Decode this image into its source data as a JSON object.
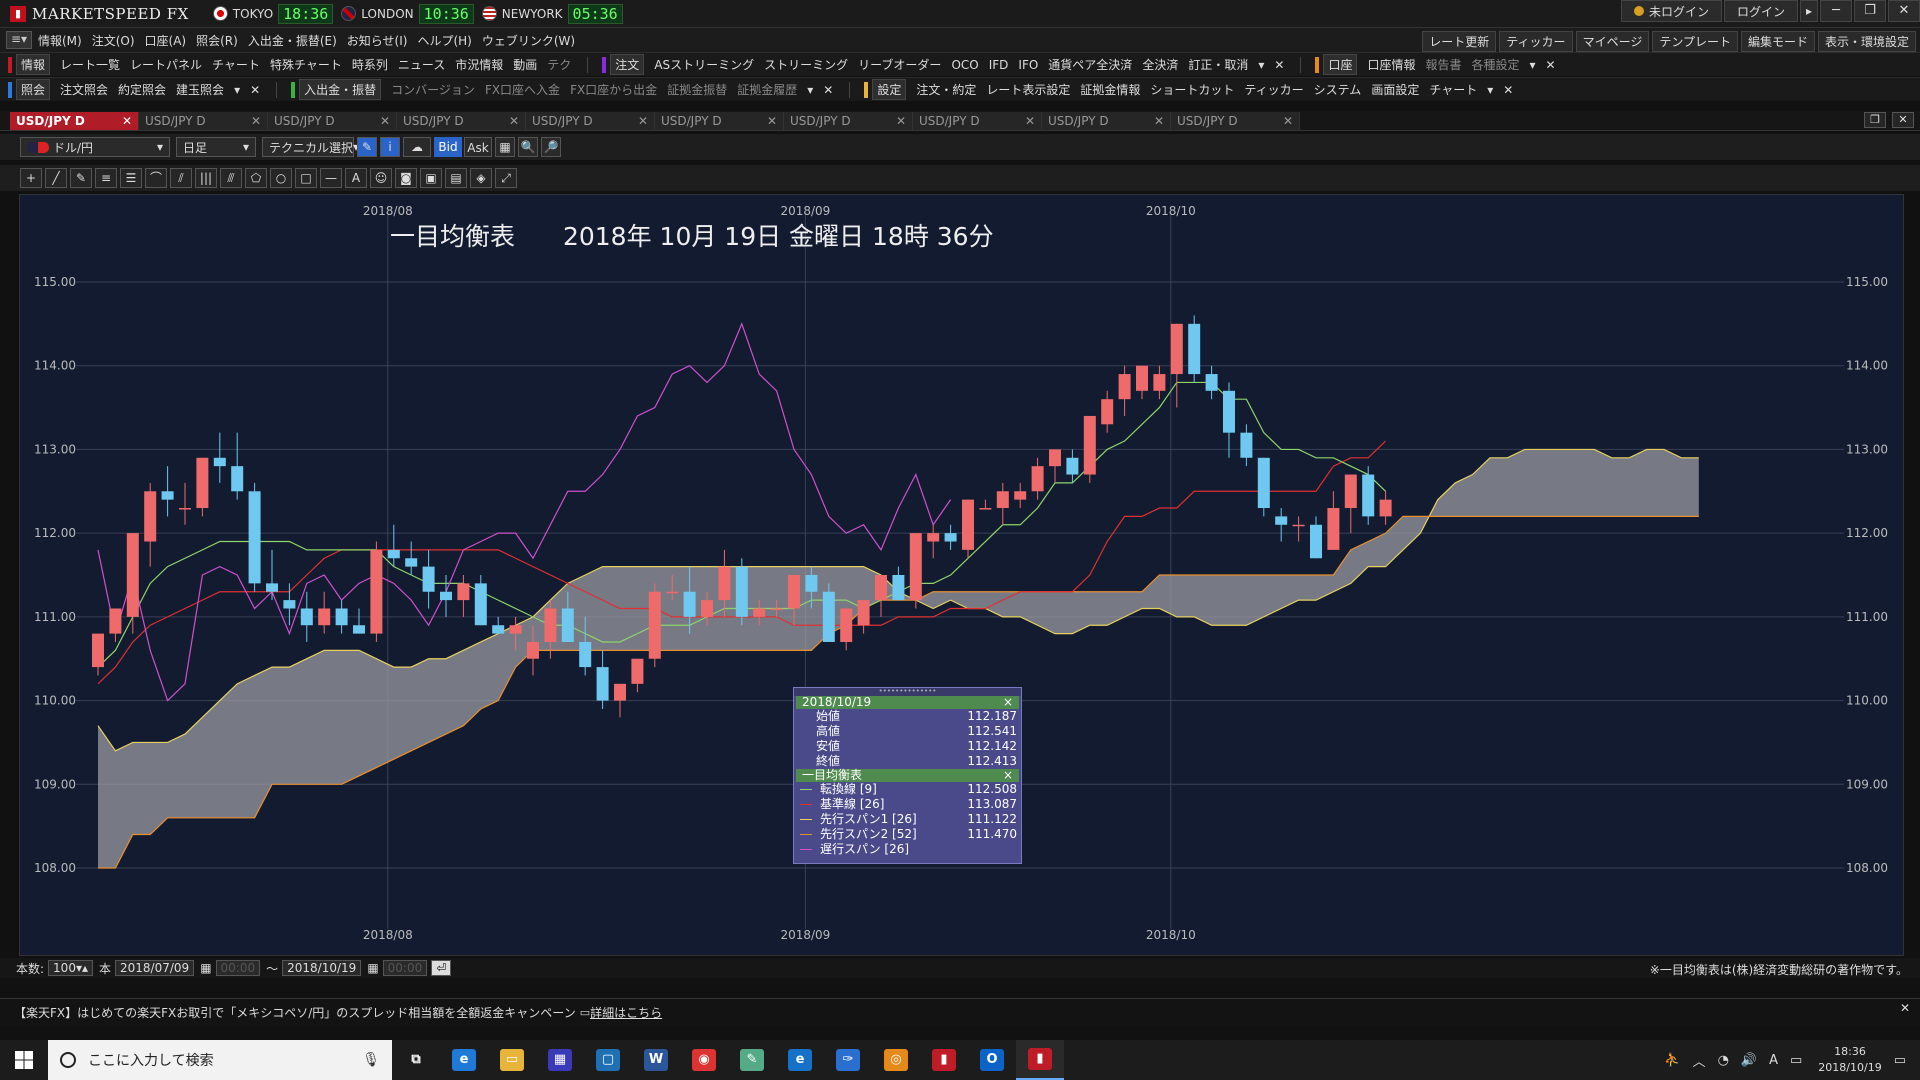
{
  "titlebar": {
    "app": "MARKETSPEED FX",
    "markets": [
      {
        "name": "TOKYO",
        "time": "18:36",
        "flag": "jp"
      },
      {
        "name": "LONDON",
        "time": "10:36",
        "flag": "uk"
      },
      {
        "name": "NEWYORK",
        "time": "05:36",
        "flag": "us"
      }
    ],
    "login_status": "未ログイン",
    "login_button": "ログイン",
    "expand_icon": "▸",
    "win": {
      "minimize": "─",
      "maximize": "❐",
      "close": "✕"
    }
  },
  "menubar": {
    "menu_icon": "≡▾",
    "items": [
      "情報(M)",
      "注文(O)",
      "口座(A)",
      "照会(R)",
      "入出金・振替(E)",
      "お知らせ(I)",
      "ヘルプ(H)",
      "ウェブリンク(W)"
    ],
    "right": [
      "レート更新",
      "ティッカー",
      "マイページ",
      "テンプレート",
      "編集モード",
      "表示・環境設定"
    ]
  },
  "toolbar1": {
    "group1": {
      "title": "情報",
      "items": [
        "レート一覧",
        "レートパネル",
        "チャート",
        "特殊チャート",
        "時系列",
        "ニュース",
        "市況情報",
        "動画",
        "テク"
      ]
    },
    "group2": {
      "title": "注文",
      "items": [
        "ASストリーミング",
        "ストリーミング",
        "リーブオーダー",
        "OCO",
        "IFD",
        "IFO",
        "通貨ペア全決済",
        "全決済",
        "訂正・取消"
      ]
    },
    "group3": {
      "title": "口座",
      "items": [
        "口座情報",
        "報告書",
        "各種設定"
      ]
    }
  },
  "toolbar2": {
    "group1": {
      "title": "照会",
      "items": [
        "注文照会",
        "約定照会",
        "建玉照会"
      ]
    },
    "group2": {
      "title": "入出金・振替",
      "items": [
        "コンバージョン",
        "FX口座へ入金",
        "FX口座から出金",
        "証拠金振替",
        "証拠金履歴"
      ]
    },
    "group3": {
      "title": "設定",
      "items": [
        "注文・約定",
        "レート表示設定",
        "証拠金情報",
        "ショートカット",
        "ティッカー",
        "システム",
        "画面設定",
        "チャート"
      ]
    },
    "dropdown_icon": "▾",
    "close_icon": "✕"
  },
  "tabs": {
    "items": [
      "USD/JPY D",
      "USD/JPY D",
      "USD/JPY D",
      "USD/JPY D",
      "USD/JPY D",
      "USD/JPY D",
      "USD/JPY D",
      "USD/JPY D",
      "USD/JPY D",
      "USD/JPY D"
    ],
    "close": "✕",
    "restore": "❐"
  },
  "controls": {
    "pair": "ドル/円",
    "period": "日足",
    "technical": "テクニカル選択",
    "bid": "Bid",
    "ask": "Ask",
    "icons": [
      "✎",
      "i",
      "☁",
      "▦",
      "🔍",
      "🔎"
    ]
  },
  "drawtools": [
    "+",
    "╱",
    "✎",
    "≡",
    "☰",
    "⌒",
    "⫽",
    "|||",
    "⫻",
    "⬠",
    "○",
    "□",
    "—",
    "A",
    "☺",
    "◙",
    "▣",
    "▤",
    "◈",
    "⤢"
  ],
  "chart_data": {
    "type": "candlestick",
    "title": "一目均衡表",
    "datetime": "2018年 10月 19日 金曜日 18時 36分",
    "y_range": [
      107.2,
      115.8
    ],
    "y_ticks": [
      "115.00",
      "114.00",
      "113.00",
      "112.00",
      "111.00",
      "110.00",
      "109.00",
      "108.00"
    ],
    "month_labels": [
      {
        "label": "2018/08",
        "index": 17
      },
      {
        "label": "2018/09",
        "index": 41
      },
      {
        "label": "2018/10",
        "index": 62
      }
    ],
    "candles": [
      [
        110.4,
        110.8,
        110.3,
        110.8
      ],
      [
        110.8,
        111.1,
        110.7,
        111.1
      ],
      [
        111.0,
        112.0,
        110.8,
        112.0
      ],
      [
        111.9,
        112.6,
        111.6,
        112.5
      ],
      [
        112.5,
        112.8,
        112.2,
        112.4
      ],
      [
        112.3,
        112.6,
        112.1,
        112.3
      ],
      [
        112.3,
        112.9,
        112.2,
        112.9
      ],
      [
        112.9,
        113.2,
        112.6,
        112.8
      ],
      [
        112.8,
        113.2,
        112.4,
        112.5
      ],
      [
        112.5,
        112.6,
        111.3,
        111.4
      ],
      [
        111.4,
        111.8,
        111.2,
        111.3
      ],
      [
        111.2,
        111.4,
        110.9,
        111.1
      ],
      [
        111.1,
        111.3,
        110.7,
        110.9
      ],
      [
        110.9,
        111.3,
        110.8,
        111.1
      ],
      [
        111.1,
        111.2,
        110.8,
        110.9
      ],
      [
        110.9,
        111.1,
        110.8,
        110.8
      ],
      [
        110.8,
        111.9,
        110.7,
        111.8
      ],
      [
        111.8,
        112.1,
        111.6,
        111.7
      ],
      [
        111.7,
        111.9,
        111.5,
        111.6
      ],
      [
        111.6,
        111.8,
        111.1,
        111.3
      ],
      [
        111.3,
        111.5,
        111.0,
        111.2
      ],
      [
        111.2,
        111.5,
        111.0,
        111.4
      ],
      [
        111.4,
        111.5,
        110.9,
        110.9
      ],
      [
        110.9,
        111.0,
        110.8,
        110.8
      ],
      [
        110.8,
        111.0,
        110.6,
        110.9
      ],
      [
        110.5,
        110.9,
        110.3,
        110.7
      ],
      [
        110.7,
        111.2,
        110.5,
        111.1
      ],
      [
        111.1,
        111.3,
        110.7,
        110.7
      ],
      [
        110.7,
        111.0,
        110.3,
        110.4
      ],
      [
        110.4,
        110.6,
        109.9,
        110.0
      ],
      [
        110.0,
        110.2,
        109.8,
        110.2
      ],
      [
        110.2,
        110.5,
        110.1,
        110.5
      ],
      [
        110.5,
        111.4,
        110.4,
        111.3
      ],
      [
        111.3,
        111.5,
        111.2,
        111.3
      ],
      [
        111.3,
        111.6,
        110.8,
        111.0
      ],
      [
        111.0,
        111.3,
        110.9,
        111.2
      ],
      [
        111.2,
        111.8,
        111.0,
        111.6
      ],
      [
        111.6,
        111.7,
        110.9,
        111.0
      ],
      [
        111.0,
        111.2,
        110.9,
        111.1
      ],
      [
        111.1,
        111.2,
        111.0,
        111.1
      ],
      [
        111.1,
        111.5,
        110.9,
        111.5
      ],
      [
        111.5,
        111.6,
        111.1,
        111.3
      ],
      [
        111.3,
        111.4,
        110.7,
        110.7
      ],
      [
        110.7,
        111.1,
        110.6,
        111.1
      ],
      [
        110.9,
        111.2,
        110.8,
        111.2
      ],
      [
        111.2,
        111.5,
        111.0,
        111.5
      ],
      [
        111.5,
        111.6,
        111.2,
        111.2
      ],
      [
        111.2,
        112.0,
        111.1,
        112.0
      ],
      [
        111.9,
        112.1,
        111.7,
        112.0
      ],
      [
        112.0,
        112.1,
        111.8,
        111.9
      ],
      [
        111.8,
        112.4,
        111.7,
        112.4
      ],
      [
        112.3,
        112.4,
        112.3,
        112.3
      ],
      [
        112.3,
        112.6,
        112.1,
        112.5
      ],
      [
        112.4,
        112.6,
        112.3,
        112.5
      ],
      [
        112.5,
        112.9,
        112.4,
        112.8
      ],
      [
        112.8,
        113.0,
        112.6,
        113.0
      ],
      [
        112.9,
        113.0,
        112.6,
        112.7
      ],
      [
        112.7,
        113.4,
        112.6,
        113.4
      ],
      [
        113.3,
        113.7,
        113.2,
        113.6
      ],
      [
        113.6,
        114.0,
        113.4,
        113.9
      ],
      [
        113.7,
        114.0,
        113.6,
        114.0
      ],
      [
        113.7,
        114.0,
        113.6,
        113.9
      ],
      [
        113.9,
        114.5,
        113.5,
        114.5
      ],
      [
        114.5,
        114.6,
        113.8,
        113.9
      ],
      [
        113.9,
        114.0,
        113.6,
        113.7
      ],
      [
        113.7,
        113.8,
        112.9,
        113.2
      ],
      [
        113.2,
        113.3,
        112.8,
        112.9
      ],
      [
        112.9,
        112.9,
        112.2,
        112.3
      ],
      [
        112.2,
        112.3,
        111.9,
        112.1
      ],
      [
        112.1,
        112.2,
        111.9,
        112.1
      ],
      [
        112.1,
        112.2,
        111.7,
        111.7
      ],
      [
        111.8,
        112.5,
        111.8,
        112.3
      ],
      [
        112.3,
        112.7,
        112.0,
        112.7
      ],
      [
        112.7,
        112.8,
        112.1,
        112.2
      ],
      [
        112.2,
        112.5,
        112.1,
        112.4
      ]
    ],
    "lines": {
      "tenkan": [
        110.4,
        110.6,
        111.0,
        111.4,
        111.6,
        111.7,
        111.8,
        111.9,
        111.9,
        111.9,
        111.9,
        111.9,
        111.8,
        111.8,
        111.8,
        111.8,
        111.8,
        111.6,
        111.5,
        111.4,
        111.4,
        111.4,
        111.3,
        111.2,
        111.1,
        111.0,
        110.9,
        110.9,
        110.8,
        110.7,
        110.7,
        110.8,
        110.9,
        110.9,
        110.9,
        111.0,
        111.1,
        111.1,
        111.1,
        111.1,
        111.1,
        111.2,
        111.2,
        111.2,
        111.1,
        111.2,
        111.3,
        111.4,
        111.4,
        111.5,
        111.7,
        111.9,
        112.1,
        112.1,
        112.3,
        112.6,
        112.6,
        112.8,
        113.0,
        113.1,
        113.3,
        113.5,
        113.8,
        113.8,
        113.8,
        113.6,
        113.6,
        113.2,
        113.0,
        113.0,
        112.9,
        112.9,
        112.8,
        112.7,
        112.5
      ],
      "kijun": [
        110.2,
        110.4,
        110.7,
        110.9,
        111.0,
        111.1,
        111.2,
        111.3,
        111.3,
        111.3,
        111.3,
        111.3,
        111.5,
        111.7,
        111.8,
        111.8,
        111.8,
        111.8,
        111.8,
        111.8,
        111.8,
        111.8,
        111.8,
        111.8,
        111.7,
        111.6,
        111.5,
        111.4,
        111.3,
        111.2,
        111.1,
        111.1,
        111.1,
        111.0,
        111.0,
        111.0,
        111.0,
        111.0,
        111.0,
        111.0,
        110.9,
        110.9,
        110.9,
        110.9,
        110.9,
        110.9,
        111.0,
        111.0,
        111.0,
        111.1,
        111.1,
        111.1,
        111.2,
        111.3,
        111.3,
        111.3,
        111.3,
        111.5,
        111.9,
        112.2,
        112.2,
        112.3,
        112.3,
        112.5,
        112.5,
        112.5,
        112.5,
        112.5,
        112.5,
        112.5,
        112.5,
        112.8,
        112.9,
        112.9,
        113.1
      ],
      "chikou": [
        111.8,
        110.8,
        111.5,
        110.6,
        110.0,
        110.2,
        111.5,
        111.6,
        111.5,
        111.1,
        111.3,
        110.8,
        111.4,
        111.5,
        111.2,
        111.4,
        111.5,
        111.4,
        111.2,
        110.9,
        111.3,
        111.8,
        111.9,
        112.0,
        112.0,
        111.7,
        112.1,
        112.5,
        112.5,
        112.7,
        113.0,
        113.4,
        113.5,
        113.9,
        114.0,
        113.8,
        114.0,
        114.5,
        113.9,
        113.7,
        113.0,
        112.7,
        112.2,
        112.0,
        112.1,
        111.8,
        112.3,
        112.7,
        112.1,
        112.4
      ],
      "span1": [
        109.7,
        109.4,
        109.5,
        109.5,
        109.5,
        109.6,
        109.8,
        110.0,
        110.2,
        110.3,
        110.4,
        110.4,
        110.5,
        110.6,
        110.6,
        110.6,
        110.5,
        110.4,
        110.4,
        110.5,
        110.5,
        110.6,
        110.7,
        110.8,
        110.9,
        111.0,
        111.2,
        111.4,
        111.5,
        111.6,
        111.6,
        111.6,
        111.6,
        111.6,
        111.6,
        111.6,
        111.6,
        111.6,
        111.6,
        111.6,
        111.6,
        111.6,
        111.6,
        111.6,
        111.6,
        111.5,
        111.3,
        111.2,
        111.1,
        111.2,
        111.1,
        111.1,
        111.0,
        111.0,
        110.9,
        110.8,
        110.8,
        110.9,
        110.9,
        111.0,
        111.1,
        111.1,
        111.0,
        111.0,
        110.9,
        110.9,
        110.9,
        111.0,
        111.1,
        111.2,
        111.2,
        111.3,
        111.4,
        111.6,
        111.6,
        111.8,
        112.0,
        112.4,
        112.6,
        112.7,
        112.9,
        112.9,
        113.0,
        113.0,
        113.0,
        113.0,
        113.0,
        112.9,
        112.9,
        113.0,
        113.0,
        112.9,
        112.9
      ],
      "span2": [
        108.0,
        108.0,
        108.4,
        108.4,
        108.6,
        108.6,
        108.6,
        108.6,
        108.6,
        108.6,
        109.0,
        109.0,
        109.0,
        109.0,
        109.0,
        109.1,
        109.2,
        109.3,
        109.4,
        109.5,
        109.6,
        109.7,
        109.9,
        110.0,
        110.4,
        110.6,
        110.6,
        110.6,
        110.6,
        110.6,
        110.6,
        110.6,
        110.6,
        110.6,
        110.6,
        110.6,
        110.6,
        110.6,
        110.6,
        110.6,
        110.6,
        110.6,
        110.8,
        110.9,
        111.1,
        111.2,
        111.2,
        111.2,
        111.3,
        111.3,
        111.3,
        111.3,
        111.3,
        111.3,
        111.3,
        111.3,
        111.3,
        111.3,
        111.3,
        111.3,
        111.3,
        111.5,
        111.5,
        111.5,
        111.5,
        111.5,
        111.5,
        111.5,
        111.5,
        111.5,
        111.5,
        111.5,
        111.8,
        111.9,
        112.0,
        112.2,
        112.2,
        112.2,
        112.2,
        112.2,
        112.2,
        112.2,
        112.2,
        112.2,
        112.2,
        112.2,
        112.2,
        112.2,
        112.2,
        112.2,
        112.2,
        112.2,
        112.2
      ]
    }
  },
  "panel": {
    "date": "2018/10/19",
    "close_icon": "×",
    "ohlc": [
      {
        "label": "始値",
        "value": "112.187"
      },
      {
        "label": "高値",
        "value": "112.541"
      },
      {
        "label": "安値",
        "value": "112.142"
      },
      {
        "label": "終値",
        "value": "112.413"
      }
    ],
    "ichimoku_title": "一目均衡表",
    "ichimoku": [
      {
        "label": "転換線 [9]",
        "value": "112.508",
        "color": "#8fd46a"
      },
      {
        "label": "基準線 [26]",
        "value": "113.087",
        "color": "#e03030"
      },
      {
        "label": "先行スパン1 [26]",
        "value": "111.122",
        "color": "#e8d060"
      },
      {
        "label": "先行スパン2 [52]",
        "value": "111.470",
        "color": "#e89030"
      },
      {
        "label": "遅行スパン [26]",
        "value": "",
        "color": "#d050d0"
      }
    ]
  },
  "bottombar": {
    "count_label": "本数:",
    "count": "100",
    "count_unit": "本",
    "from_date": "2018/07/09",
    "from_time": "00:00",
    "tilde": "〜",
    "to_date": "2018/10/19",
    "to_time": "00:00",
    "copyright": "※一目均衡表は(株)経済変動総研の著作物です。"
  },
  "news": {
    "text": "【楽天FX】はじめての楽天FXお取引で「メキシコペソ/円」のスプレッド相当額を全額返金キャンペーン",
    "link": "詳細はこちら",
    "close": "✕"
  },
  "taskbar": {
    "search_placeholder": "ここに入力して検索",
    "apps": [
      {
        "name": "taskview",
        "glyph": "⧉",
        "color": "#1c1c1c"
      },
      {
        "name": "ie",
        "glyph": "e",
        "color": "#1e7ad6"
      },
      {
        "name": "explorer",
        "glyph": "▭",
        "color": "#e8b43a"
      },
      {
        "name": "calculator",
        "glyph": "▦",
        "color": "#3a3ab8"
      },
      {
        "name": "window",
        "glyph": "▢",
        "color": "#1f6fb4"
      },
      {
        "name": "word",
        "glyph": "W",
        "color": "#2b579a"
      },
      {
        "name": "chrome",
        "glyph": "◉",
        "color": "#d33"
      },
      {
        "name": "paint",
        "glyph": "✎",
        "color": "#5a8"
      },
      {
        "name": "edge",
        "glyph": "e",
        "color": "#1570c8"
      },
      {
        "name": "ink",
        "glyph": "✑",
        "color": "#2a6ed0"
      },
      {
        "name": "app-orange",
        "glyph": "◎",
        "color": "#e58a1a"
      },
      {
        "name": "ispeed",
        "glyph": "▮",
        "color": "#c01c28"
      },
      {
        "name": "outlook",
        "glyph": "O",
        "color": "#0a64c8"
      },
      {
        "name": "marketspeed",
        "glyph": "▮",
        "color": "#c01c28",
        "active": true
      }
    ],
    "tray": {
      "people": "⛹",
      "chevron": "︿",
      "network": "◔",
      "volume": "🔊",
      "ime": "A",
      "notif": "▭"
    },
    "time": "18:36",
    "date": "2018/10/19"
  }
}
